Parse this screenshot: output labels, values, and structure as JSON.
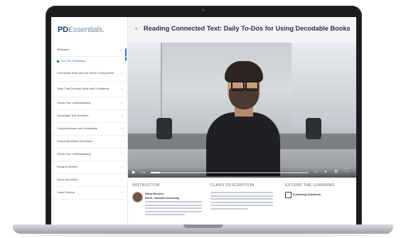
{
  "brand": {
    "logo_bold": "PD",
    "logo_light": "Essentials."
  },
  "sidebar": {
    "items": [
      {
        "label": "Welcome",
        "chevron": "⌄"
      },
      {
        "label": "The Gift of Reading",
        "sub": true
      },
      {
        "label": "Connected Texts and the Seven Components",
        "chevron": "›"
      },
      {
        "label": "Texts That Develop Skills and Confidence",
        "chevron": "›"
      },
      {
        "label": "Check Your Understanding",
        "chevron": "›"
      },
      {
        "label": "Decodable Text Routines",
        "chevron": "›"
      },
      {
        "label": "Comprehension and Vocabulary",
        "chevron": "›"
      },
      {
        "label": "Frequently Asked Questions",
        "chevron": "›"
      },
      {
        "label": "Check Your Understanding",
        "chevron": "›"
      },
      {
        "label": "Recap & Reflect",
        "chevron": "›"
      },
      {
        "label": "About the Author",
        "chevron": "›"
      },
      {
        "label": "Class Preview",
        "chevron": "›"
      }
    ]
  },
  "main": {
    "back_icon": "«",
    "title": "Reading Connected Text: Daily To-Dos for Using Decodable Books"
  },
  "video": {
    "time": "7:14",
    "progress": 0.06,
    "play_icon": "▶",
    "icons": [
      "captions-icon",
      "volume-icon",
      "settings-icon",
      "fullscreen-icon"
    ]
  },
  "info": {
    "instructor_heading": "INSTRUCTOR",
    "instructor_name": "Wiley Blevins,",
    "instructor_credential": "Ed.M., Harvard University",
    "description_heading": "CLASS DESCRIPTION",
    "extend_heading": "EXTEND THE LEARNING",
    "notebook_label": "E-learning Notebook"
  },
  "colors": {
    "accent": "#2f6fc0",
    "brand": "#1f3b73"
  }
}
